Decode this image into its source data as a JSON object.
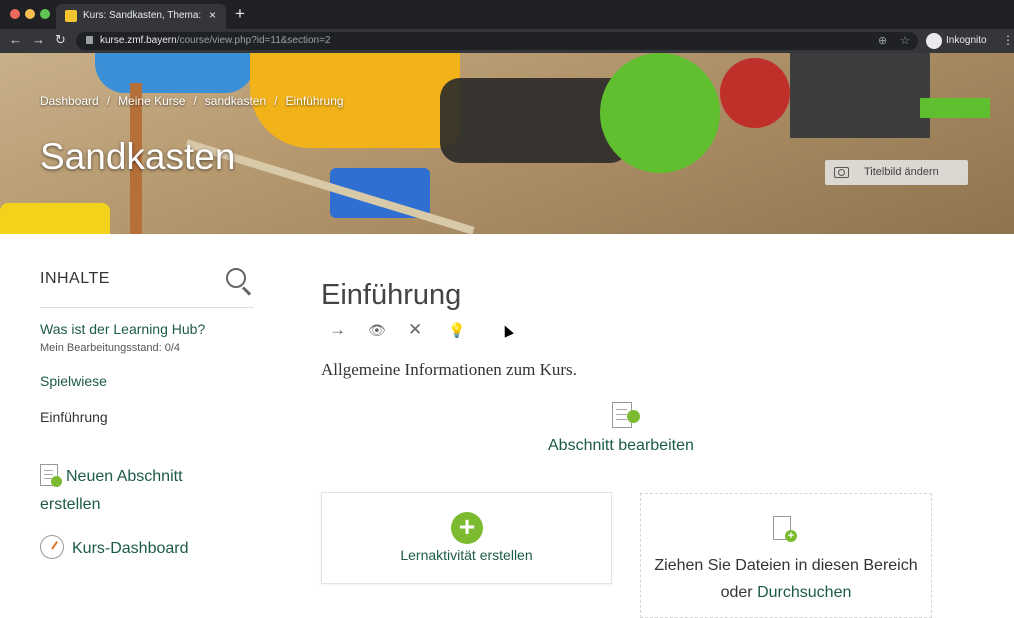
{
  "browser": {
    "tab_title": "Kurs: Sandkasten, Thema: Einführung",
    "tab_close": "×",
    "new_tab": "+",
    "url_host": "kurse.zmf.bayern",
    "url_path": "/course/view.php?id=11&section=2",
    "incognito_label": "Inkognito",
    "nav_back": "←",
    "nav_forward": "→",
    "nav_reload": "↻",
    "zoom_icon": "⊕",
    "star_icon": "☆",
    "menu_icon": "⋮"
  },
  "header": {
    "breadcrumb": [
      "Dashboard",
      "Meine Kurse",
      "sandkasten",
      "Einführung"
    ],
    "breadcrumb_separator": "/",
    "course_title": "Sandkasten",
    "change_image_label": "Titelbild ändern"
  },
  "sidebar": {
    "heading": "INHALTE",
    "items": [
      {
        "label": "Was ist der Learning Hub?",
        "subtext": "Mein Bearbeitungsstand: 0/4"
      },
      {
        "label": "Spielwiese"
      },
      {
        "label": "Einführung"
      }
    ],
    "new_section_label": "Neuen Abschnitt erstellen",
    "dashboard_label": "Kurs-Dashboard"
  },
  "section": {
    "title": "Einführung",
    "icons": {
      "move": "→",
      "visibility": "👁",
      "delete": "✕",
      "highlight": "💡"
    },
    "summary": "Allgemeine Informationen zum Kurs.",
    "edit_label": "Abschnitt bearbeiten",
    "add_activity_label": "Lernaktivität erstellen",
    "add_icon": "+",
    "dropzone_text": "Ziehen Sie Dateien in diesen Bereich oder",
    "dropzone_link": "Durchsuchen"
  },
  "colors": {
    "accent_green": "#7cba2f",
    "link_green": "#1c5a4a"
  }
}
